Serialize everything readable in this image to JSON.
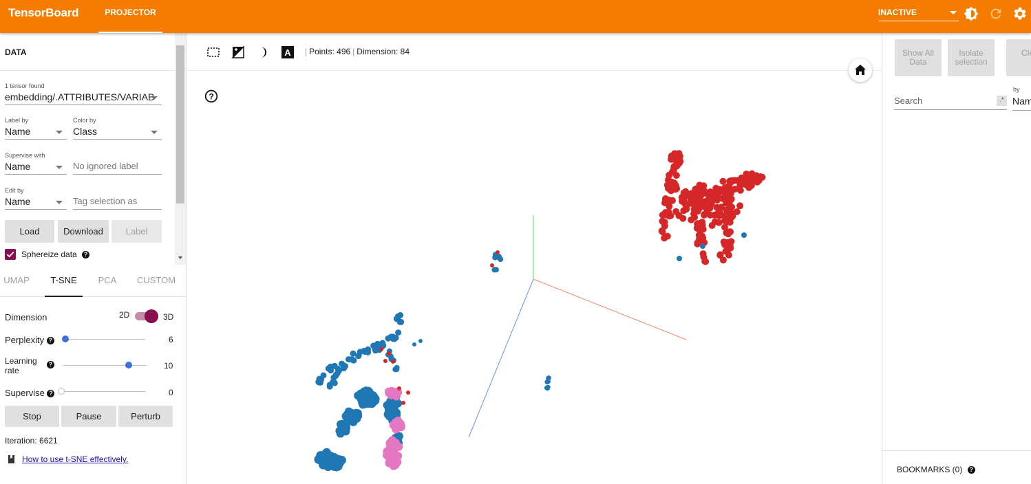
{
  "app": {
    "brand": "TensorBoard",
    "active_tab": "PROJECTOR",
    "run_select": "INACTIVE",
    "icons": [
      "brightness-icon",
      "refresh-icon",
      "settings-icon"
    ]
  },
  "data_panel": {
    "title": "DATA",
    "tensor_caption": "1 tensor found",
    "tensor_value": "embedding/.ATTRIBUTES/VARIAB",
    "label_by": {
      "label": "Label by",
      "value": "Name"
    },
    "color_by": {
      "label": "Color by",
      "value": "Class"
    },
    "supervise_with": {
      "label": "Supervise with",
      "value": "Name",
      "placeholder": "No ignored label"
    },
    "edit_by": {
      "label": "Edit by",
      "value": "Name",
      "placeholder": "Tag selection as"
    },
    "buttons": {
      "load": "Load",
      "download": "Download",
      "label": "Label"
    },
    "sphereize": {
      "label": "Sphereize data",
      "checked": true
    }
  },
  "projection_tabs": [
    "UMAP",
    "T-SNE",
    "PCA",
    "CUSTOM"
  ],
  "active_projection": "T-SNE",
  "tsne": {
    "dimension_label": "Dimension",
    "dim_2d": "2D",
    "dim_3d": "3D",
    "dimension_selected": "3D",
    "perplexity": {
      "label": "Perplexity",
      "value": "6",
      "level": 0.03
    },
    "learning_rate": {
      "label_line1": "Learning",
      "label_line2": "rate",
      "value": "10",
      "level": 0.8
    },
    "supervise": {
      "label": "Supervise",
      "value": "0",
      "level": 0.0
    },
    "buttons": {
      "stop": "Stop",
      "pause": "Pause",
      "perturb": "Perturb"
    },
    "iteration": "Iteration: 6621",
    "help_link": "How to use t-SNE effectively."
  },
  "toolbar": {
    "points": "Points: 496",
    "dimension": "Dimension: 84",
    "icons": [
      "select-icon",
      "night-mode-icon",
      "moon-icon",
      "label-icon",
      "home-icon",
      "help-icon"
    ]
  },
  "colors": {
    "accent": "#f57c00",
    "toggle": "#880e4f",
    "class_a": "#d62728",
    "class_b": "#1f77b4",
    "class_c": "#e377c2"
  },
  "inspector": {
    "show_all": "Show All Data",
    "isolate": "Isolate selection",
    "clear": "Clear selection",
    "search_placeholder": "Search",
    "regex": ".*",
    "by_label": "by",
    "by_value": "Name",
    "bookmarks": "BOOKMARKS (0)"
  }
}
